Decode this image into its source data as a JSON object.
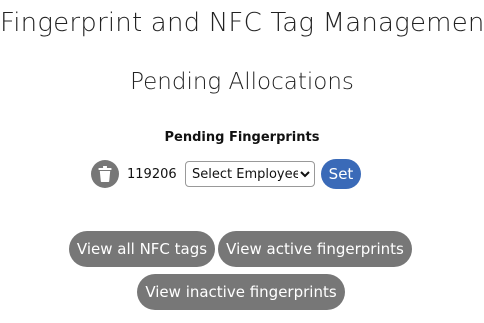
{
  "header": {
    "title": "Fingerprint and NFC Tag Management",
    "section_title": "Pending Allocations"
  },
  "pending_fingerprints": {
    "heading": "Pending Fingerprints",
    "rows": [
      {
        "id": "119206",
        "select_value": "Select Employee",
        "set_label": "Set"
      }
    ]
  },
  "actions": {
    "view_all_nfc": "View all NFC tags",
    "view_active": "View active fingerprints",
    "view_inactive": "View inactive fingerprints"
  },
  "colors": {
    "pill_bg": "#777777",
    "set_button": "#3a6ab8"
  },
  "icons": {
    "delete": "trash-icon",
    "dropdown": "chevron-down-icon"
  }
}
